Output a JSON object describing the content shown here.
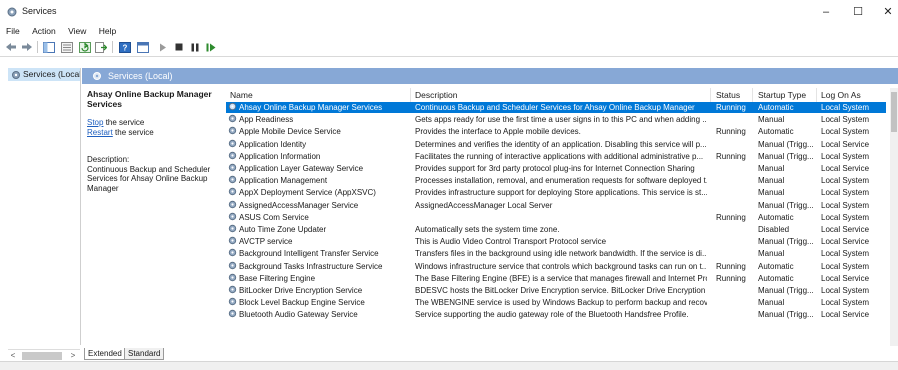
{
  "window": {
    "title": "Services",
    "controls": [
      "–",
      "☐",
      "✕"
    ]
  },
  "menu": [
    "File",
    "Action",
    "View",
    "Help"
  ],
  "toolbar_icons": [
    "back-icon",
    "forward-icon",
    "show-hide-tree-icon",
    "properties-icon",
    "refresh-icon",
    "export-list-icon",
    "help-icon",
    "console-icon",
    "start-service-icon",
    "stop-service-icon",
    "pause-service-icon",
    "resume-service-icon"
  ],
  "tree": {
    "item": "Services (Local"
  },
  "panel": {
    "header": "Services (Local)"
  },
  "description_pane": {
    "service_name": "Ahsay Online Backup Manager Services",
    "stop_link": "Stop",
    "stop_text": " the service",
    "restart_link": "Restart",
    "restart_text": " the service",
    "desc_label": "Description:",
    "desc_text": "Continuous Backup and Scheduler Services for Ahsay Online Backup Manager"
  },
  "columns": [
    "Name",
    "Description",
    "Status",
    "Startup Type",
    "Log On As"
  ],
  "rows": [
    {
      "name": "Ahsay Online Backup Manager Services",
      "description": "Continuous Backup and Scheduler Services for Ahsay Online Backup Manager",
      "status": "Running",
      "startup": "Automatic",
      "logon": "Local System",
      "selected": true
    },
    {
      "name": "App Readiness",
      "description": "Gets apps ready for use the first time a user signs in to this PC and when adding ...",
      "status": "",
      "startup": "Manual",
      "logon": "Local System"
    },
    {
      "name": "Apple Mobile Device Service",
      "description": "Provides the interface to Apple mobile devices.",
      "status": "Running",
      "startup": "Automatic",
      "logon": "Local System"
    },
    {
      "name": "Application Identity",
      "description": "Determines and verifies the identity of an application. Disabling this service will p...",
      "status": "",
      "startup": "Manual (Trigg...",
      "logon": "Local Service"
    },
    {
      "name": "Application Information",
      "description": "Facilitates the running of interactive applications with additional administrative p...",
      "status": "Running",
      "startup": "Manual (Trigg...",
      "logon": "Local System"
    },
    {
      "name": "Application Layer Gateway Service",
      "description": "Provides support for 3rd party protocol plug-ins for Internet Connection Sharing",
      "status": "",
      "startup": "Manual",
      "logon": "Local Service"
    },
    {
      "name": "Application Management",
      "description": "Processes installation, removal, and enumeration requests for software deployed t...",
      "status": "",
      "startup": "Manual",
      "logon": "Local System"
    },
    {
      "name": "AppX Deployment Service (AppXSVC)",
      "description": "Provides infrastructure support for deploying Store applications. This service is st...",
      "status": "",
      "startup": "Manual",
      "logon": "Local System"
    },
    {
      "name": "AssignedAccessManager Service",
      "description": "AssignedAccessManager Local Server",
      "status": "",
      "startup": "Manual (Trigg...",
      "logon": "Local System"
    },
    {
      "name": "ASUS Com Service",
      "description": "",
      "status": "Running",
      "startup": "Automatic",
      "logon": "Local System"
    },
    {
      "name": "Auto Time Zone Updater",
      "description": "Automatically sets the system time zone.",
      "status": "",
      "startup": "Disabled",
      "logon": "Local Service"
    },
    {
      "name": "AVCTP service",
      "description": "This is Audio Video Control Transport Protocol service",
      "status": "",
      "startup": "Manual (Trigg...",
      "logon": "Local Service"
    },
    {
      "name": "Background Intelligent Transfer Service",
      "description": "Transfers files in the background using idle network bandwidth. If the service is di...",
      "status": "",
      "startup": "Manual",
      "logon": "Local System"
    },
    {
      "name": "Background Tasks Infrastructure Service",
      "description": "Windows infrastructure service that controls which background tasks can run on t...",
      "status": "Running",
      "startup": "Automatic",
      "logon": "Local System"
    },
    {
      "name": "Base Filtering Engine",
      "description": "The Base Filtering Engine (BFE) is a service that manages firewall and Internet Prot...",
      "status": "Running",
      "startup": "Automatic",
      "logon": "Local Service"
    },
    {
      "name": "BitLocker Drive Encryption Service",
      "description": "BDESVC hosts the BitLocker Drive Encryption service. BitLocker Drive Encryption p...",
      "status": "",
      "startup": "Manual (Trigg...",
      "logon": "Local System"
    },
    {
      "name": "Block Level Backup Engine Service",
      "description": "The WBENGINE service is used by Windows Backup to perform backup and recov...",
      "status": "",
      "startup": "Manual",
      "logon": "Local System"
    },
    {
      "name": "Bluetooth Audio Gateway Service",
      "description": "Service supporting the audio gateway role of the Bluetooth Handsfree Profile.",
      "status": "",
      "startup": "Manual (Trigg...",
      "logon": "Local Service"
    }
  ],
  "tabs": [
    "Extended",
    "Standard"
  ],
  "tree_scroll": {
    "left": "<",
    "right": ">"
  },
  "colors": {
    "selection": "#0078d7",
    "header_band": "#87a8d6",
    "tree_selected": "#cde4f7",
    "link": "#1f5fbf"
  }
}
